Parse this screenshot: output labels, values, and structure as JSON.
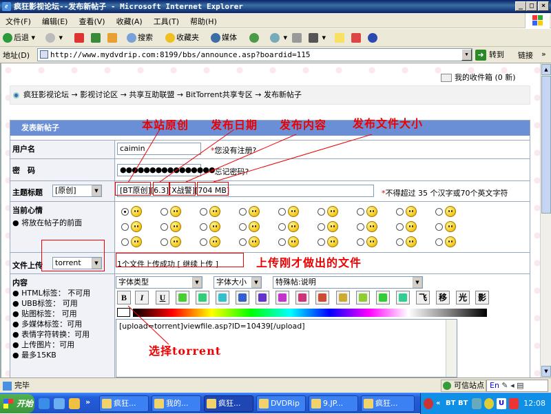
{
  "window": {
    "title": "疯狂影视论坛--发布新帖子 - Microsoft Internet Explorer",
    "min": "_",
    "max": "□",
    "close": "×"
  },
  "menu": [
    "文件(F)",
    "编辑(E)",
    "查看(V)",
    "收藏(A)",
    "工具(T)",
    "帮助(H)"
  ],
  "toolbar": {
    "back": "后退",
    "search": "搜索",
    "favorites": "收藏夹",
    "media": "媒体"
  },
  "address": {
    "label": "地址(D)",
    "url": "http://www.mydvdrip.com:8199/bbs/announce.asp?boardid=115",
    "go": "转到",
    "links": "链接"
  },
  "page": {
    "inbox": "我的收件箱 (0 新)",
    "breadcrumb": "疯狂影视论坛 → 影视讨论区 → 共享互助联盟 → BitTorrent共享专区 → 发布新帖子",
    "form_title": "发表新帖子",
    "username_label": "用户名",
    "username_value": "caimin",
    "not_registered": "您没有注册?",
    "password_label": "密　码",
    "password_value": "●●●●●●●●●●●●●●●●",
    "forgot_password": "忘记密码?",
    "subject_label": "主题标题",
    "subject_select": "[原创]",
    "subject_value": "[BT原创][6.3][X战警][704 MB]",
    "subject_hint": "不得超过 35 个汉字或70个英文字符",
    "mood_label": "当前心情",
    "mood_hint": "● 将放在帖子的前面",
    "upload_label": "文件上传",
    "upload_select": "torrent",
    "upload_status": "1个文件上传成功 [ 继续上传 ]",
    "content_label": "内容",
    "content_rules": [
      "HTML标签：  不可用",
      "UBB标签：  可用",
      "贴图标签：  可用",
      "多媒体标签：可用",
      "表情字符转换：可用",
      "上传图片：可用",
      "最多15KB"
    ],
    "font_type": "字体类型",
    "font_size": "字体大小",
    "special_post": "特殊帖:说明",
    "editor_buttons": [
      "B",
      "I",
      "U",
      "飞",
      "移",
      "光",
      "影"
    ],
    "editor_text": "[upload=torrent]viewfile.asp?ID=10439[/upload]"
  },
  "annotations": {
    "original": "本站原创",
    "date": "发布日期",
    "content": "发布内容",
    "size": "发布文件大小",
    "uploaded": "上传刚才做出的文件",
    "choose": "选择torrent"
  },
  "status": {
    "text": "完毕",
    "zone": "可信站点",
    "lang": "En"
  },
  "taskbar": {
    "start": "开始",
    "tasks": [
      "疯狂...",
      "我的...",
      "疯狂...",
      "DVDRip",
      "9.JP...",
      "疯狂..."
    ],
    "tray_labels": [
      "BT",
      "BT"
    ],
    "clock": "12:08"
  },
  "colors": {
    "title_bar": "#0a246a",
    "form_header": "#6b8fd6",
    "annotation": "#ee0000",
    "taskbar": "#245edb",
    "start": "#3c963c"
  }
}
